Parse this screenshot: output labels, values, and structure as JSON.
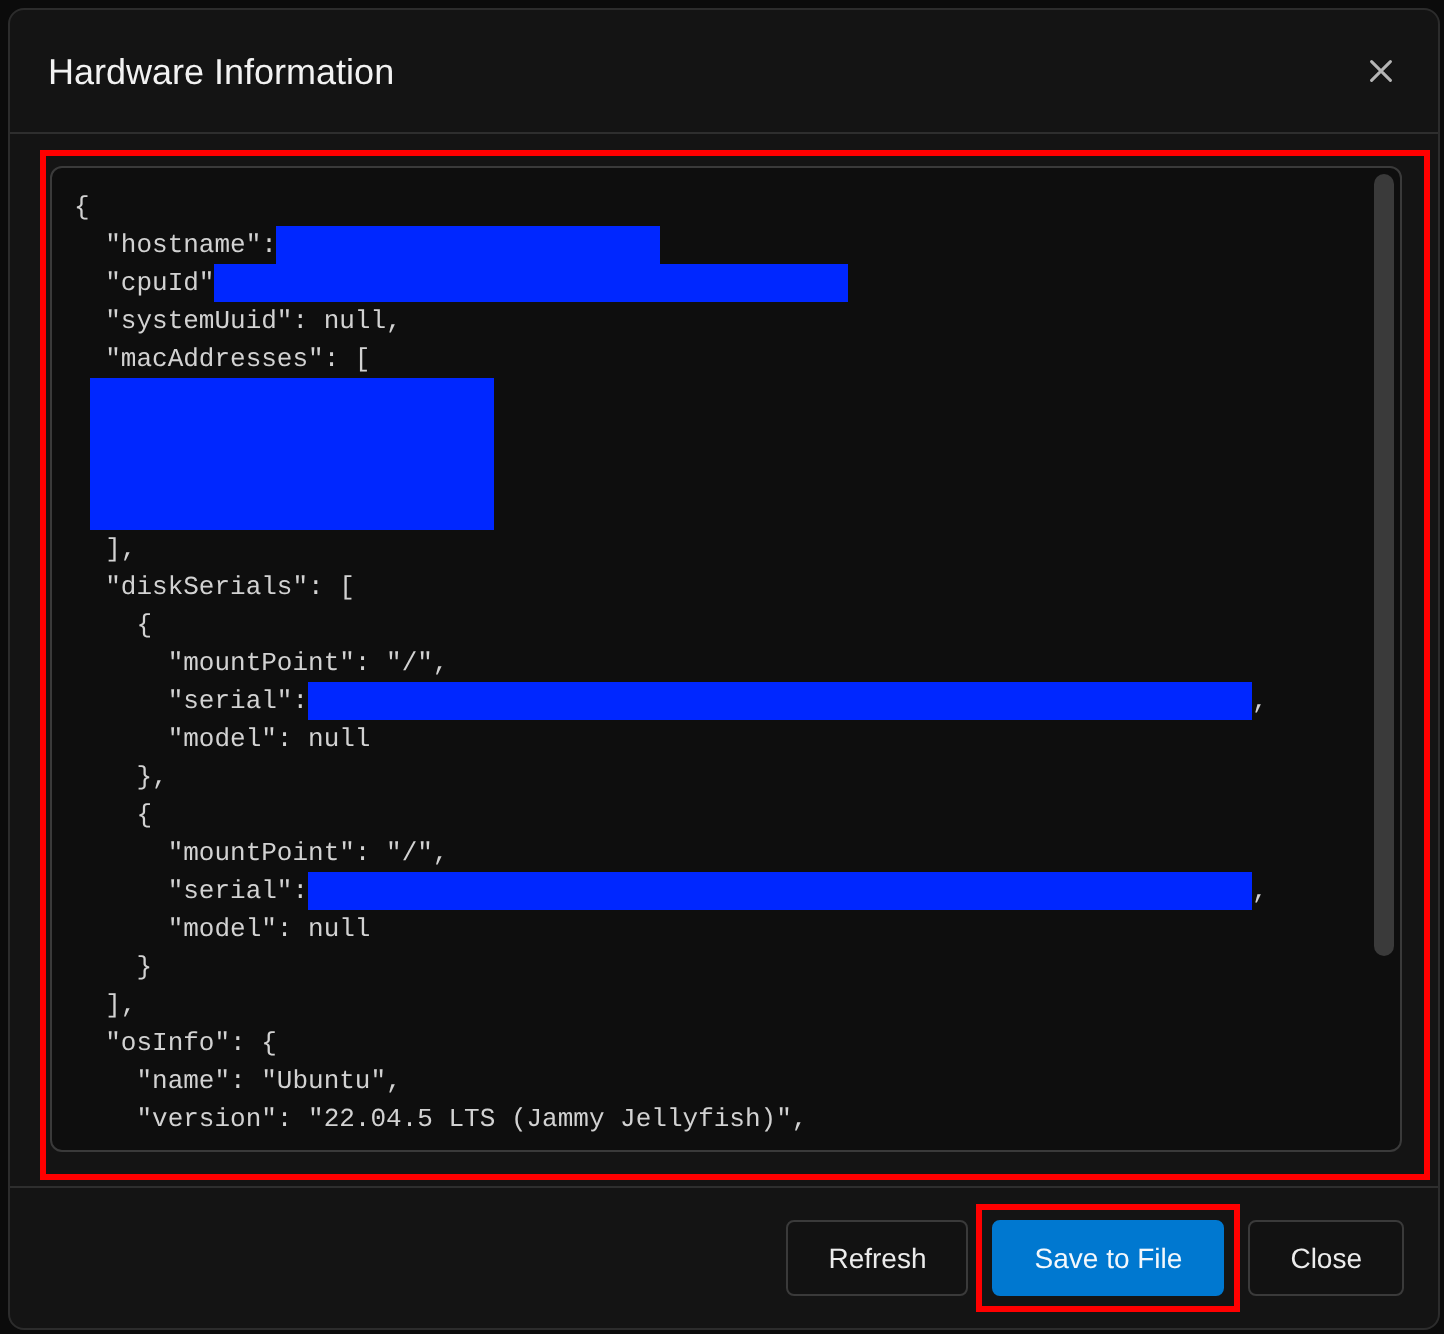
{
  "dialog": {
    "title": "Hardware Information"
  },
  "code_panel": {
    "highlighted": true,
    "lines": [
      {
        "kind": "code",
        "text": "{"
      },
      {
        "kind": "masked_short",
        "text": "  \"hostname\":"
      },
      {
        "kind": "masked_medium",
        "text": "  \"cpuId\""
      },
      {
        "kind": "code",
        "text": "  \"systemUuid\": null,"
      },
      {
        "kind": "code",
        "text": "  \"macAddresses\": ["
      },
      {
        "kind": "redacted"
      },
      {
        "kind": "redacted"
      },
      {
        "kind": "redacted"
      },
      {
        "kind": "redacted"
      },
      {
        "kind": "code",
        "text": "  ],"
      },
      {
        "kind": "code",
        "text": "  \"diskSerials\": ["
      },
      {
        "kind": "code",
        "text": "    {"
      },
      {
        "kind": "code",
        "text": "      \"mountPoint\": \"/\","
      },
      {
        "kind": "masked_long",
        "text": "      \"serial\":",
        "after": ","
      },
      {
        "kind": "code",
        "text": "      \"model\": null"
      },
      {
        "kind": "code",
        "text": "    },"
      },
      {
        "kind": "code",
        "text": "    {"
      },
      {
        "kind": "code",
        "text": "      \"mountPoint\": \"/\","
      },
      {
        "kind": "masked_long",
        "text": "      \"serial\":",
        "after": ","
      },
      {
        "kind": "code",
        "text": "      \"model\": null"
      },
      {
        "kind": "code",
        "text": "    }"
      },
      {
        "kind": "code",
        "text": "  ],"
      },
      {
        "kind": "code",
        "text": "  \"osInfo\": {"
      },
      {
        "kind": "code",
        "text": "    \"name\": \"Ubuntu\","
      },
      {
        "kind": "code",
        "text": "    \"version\": \"22.04.5 LTS (Jammy Jellyfish)\","
      }
    ]
  },
  "buttons": [
    {
      "label": "Refresh",
      "kind": "secondary",
      "highlighted": false
    },
    {
      "label": "Save to File",
      "kind": "primary",
      "highlighted": true
    },
    {
      "label": "Close",
      "kind": "secondary",
      "highlighted": false
    }
  ]
}
